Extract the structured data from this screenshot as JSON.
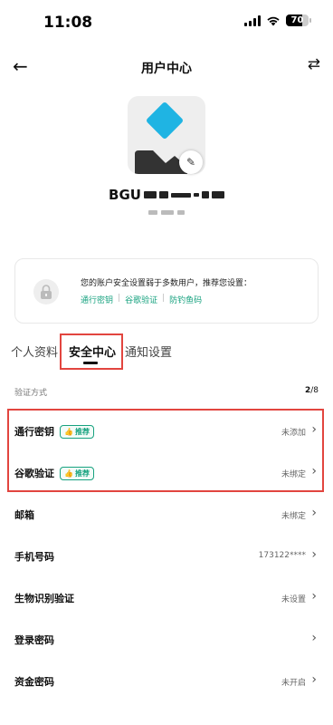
{
  "status_bar": {
    "time": "11:08",
    "battery": "70",
    "battery_level": 0.7,
    "icons": [
      "signal-icon",
      "wifi-icon",
      "battery-icon"
    ]
  },
  "nav": {
    "back_icon": "arrow-left-icon",
    "title": "用户中心",
    "switch_icon": "swap-icon"
  },
  "profile": {
    "username_prefix": "BGU",
    "avatar_icon": "diamond-logo",
    "edit_icon": "pencil-icon"
  },
  "security_tip": {
    "text": "您的账户安全设置弱于多数用户，推荐您设置：",
    "links": [
      "通行密钥",
      "谷歌验证",
      "防钓鱼码"
    ],
    "separator": "|",
    "icon": "lock-icon"
  },
  "tabs": [
    {
      "label": "个人资料",
      "active": false
    },
    {
      "label": "安全中心",
      "active": true
    },
    {
      "label": "通知设置",
      "active": false
    }
  ],
  "verification": {
    "header": "验证方式",
    "count_done": "2",
    "count_total": "/8"
  },
  "rows": [
    {
      "label": "通行密钥",
      "badge": "推荐",
      "status": "未添加"
    },
    {
      "label": "谷歌验证",
      "badge": "推荐",
      "status": "未绑定"
    },
    {
      "label": "邮箱",
      "badge": "",
      "status": "未绑定"
    },
    {
      "label": "手机号码",
      "badge": "",
      "status": "173122****"
    },
    {
      "label": "生物识别验证",
      "badge": "",
      "status": "未设置"
    },
    {
      "label": "登录密码",
      "badge": "",
      "status": ""
    },
    {
      "label": "资金密码",
      "badge": "",
      "status": "未开启"
    }
  ],
  "colors": {
    "accent": "#17a27f",
    "logo": "#1fb4e3",
    "highlight": "#e2453f"
  }
}
